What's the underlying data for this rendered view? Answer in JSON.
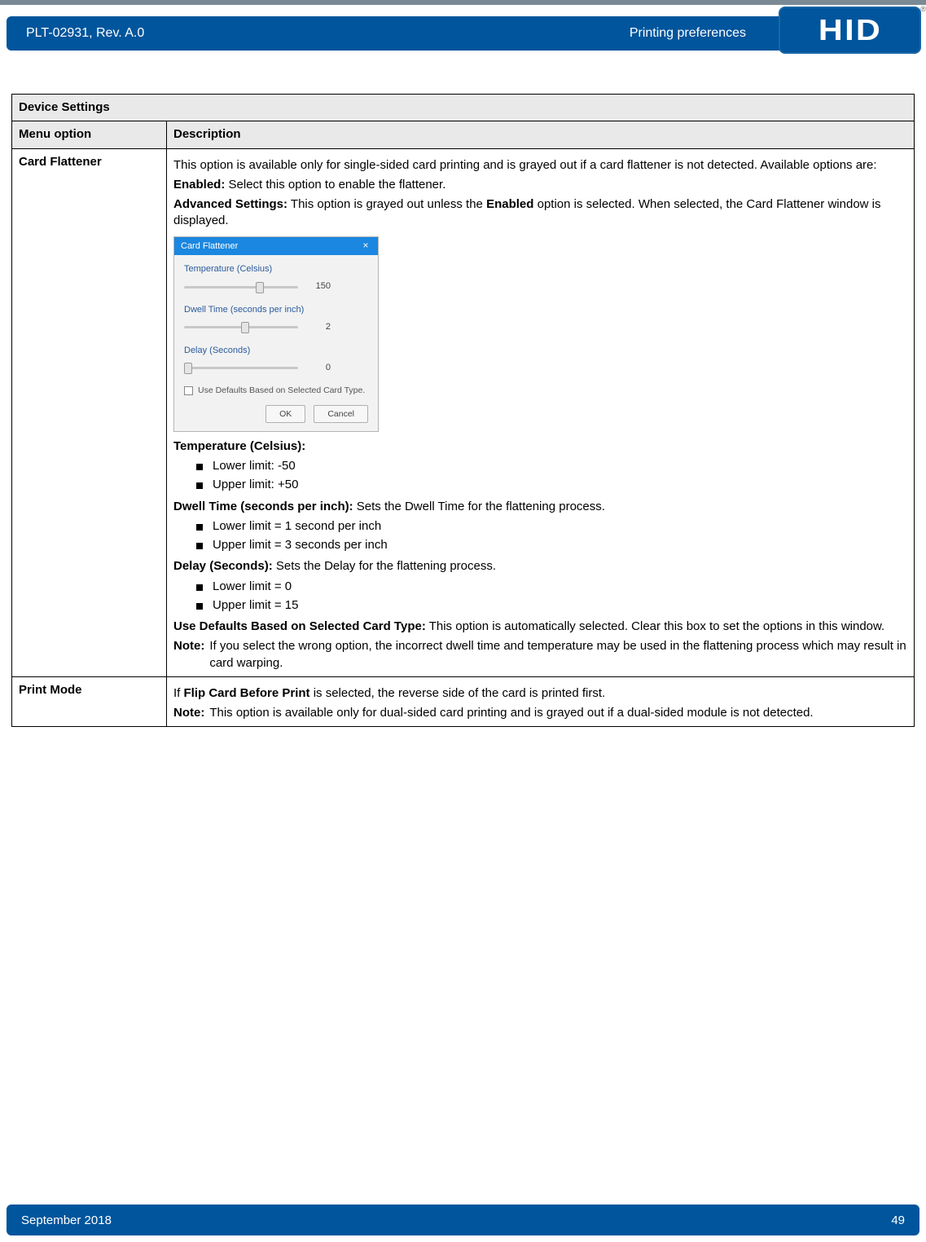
{
  "header": {
    "doc_id": "PLT-02931, Rev. A.0",
    "section_title": "Printing preferences",
    "brand": "HID",
    "registered_mark": "®"
  },
  "table": {
    "title": "Device Settings",
    "col1_header": "Menu option",
    "col2_header": "Description",
    "rows": {
      "card_flattener": {
        "menu": "Card Flattener",
        "intro": "This option is available only for single-sided card printing and is grayed out if a card flattener is not detected. Available options are:",
        "enabled_label": "Enabled:",
        "enabled_text": " Select this option to enable the flattener.",
        "adv_label": "Advanced Settings:",
        "adv_text_a": " This option is grayed out unless the ",
        "adv_bold": "Enabled",
        "adv_text_b": " option is selected. When selected, the Card Flattener window is displayed.",
        "dialog": {
          "title": "Card Flattener",
          "temp_label": "Temperature (Celsius)",
          "temp_value": "150",
          "dwell_label": "Dwell Time (seconds per inch)",
          "dwell_value": "2",
          "delay_label": "Delay (Seconds)",
          "delay_value": "0",
          "check_label": "Use Defaults Based on Selected Card Type.",
          "ok": "OK",
          "cancel": "Cancel"
        },
        "temp_heading": "Temperature (Celsius):",
        "temp_items": [
          "Lower limit: -50",
          "Upper limit: +50"
        ],
        "dwell_heading": "Dwell Time (seconds per inch):",
        "dwell_heading_text": " Sets the Dwell Time for the flattening process.",
        "dwell_items": [
          "Lower limit = 1 second per inch",
          "Upper limit = 3 seconds per inch"
        ],
        "delay_heading": "Delay (Seconds):",
        "delay_heading_text": " Sets the Delay for the flattening process.",
        "delay_items": [
          "Lower limit = 0",
          "Upper limit = 15"
        ],
        "defaults_label": "Use Defaults Based on Selected Card Type:",
        "defaults_text": " This option is automatically selected. Clear this box to set the options in this window.",
        "note_label": "Note:",
        "note_text": "If you select the wrong option, the incorrect dwell time and temperature may be used in the flattening process which may result in card warping."
      },
      "print_mode": {
        "menu": "Print Mode",
        "line1_a": "If ",
        "line1_bold": "Flip Card Before Print",
        "line1_b": " is selected, the reverse side of the card is printed first.",
        "note_label": "Note:",
        "note_text": "This option is available only for dual-sided card printing and is grayed out if a dual-sided module is not detected."
      }
    }
  },
  "footer": {
    "date": "September 2018",
    "page": "49"
  }
}
